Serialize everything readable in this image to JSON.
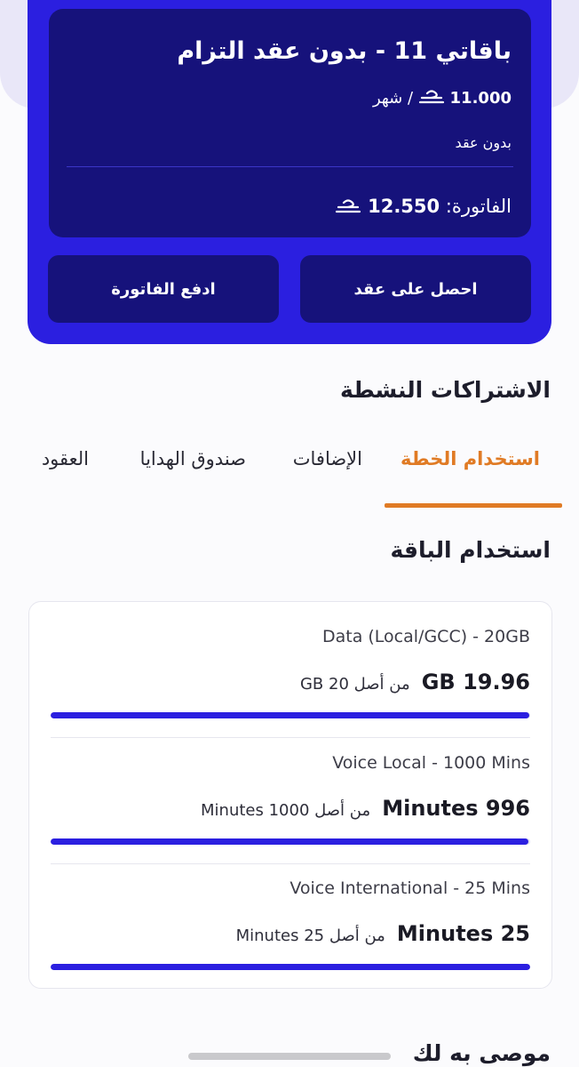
{
  "plan": {
    "title": "باقاتي 11 - بدون عقد التزام",
    "price_value": "11.000",
    "price_period": "/ شهر",
    "contract_type": "بدون عقد",
    "bill_label": "الفاتورة:",
    "bill_value": "12.550",
    "currency_icon": "omani-rial-icon",
    "buttons": {
      "get_contract": "احصل على عقد",
      "pay_bill": "ادفع الفاتورة"
    }
  },
  "active_subscriptions": {
    "title": "الاشتراكات النشطة",
    "tabs": [
      "استخدام الخطة",
      "الإضافات",
      "صندوق الهدايا",
      "العقود"
    ],
    "active_tab": 0
  },
  "plan_usage": {
    "title": "استخدام الباقة",
    "items": [
      {
        "label": "Data (Local/GCC) - 20GB",
        "used": "GB 19.96",
        "total_text": "من أصل 20 GB",
        "fraction_remaining": 0.998
      },
      {
        "label": "Voice Local - 1000 Mins",
        "used": "Minutes 996",
        "total_text": "من أصل 1000 Minutes",
        "fraction_remaining": 0.996
      },
      {
        "label": "Voice International - 25 Mins",
        "used": "Minutes 25",
        "total_text": "من أصل 25 Minutes",
        "fraction_remaining": 1.0
      }
    ]
  },
  "recommended": {
    "title": "موصى به لك"
  },
  "colors": {
    "primary": "#2b1fe0",
    "card_dark": "#16127b",
    "accent": "#e07b25"
  }
}
